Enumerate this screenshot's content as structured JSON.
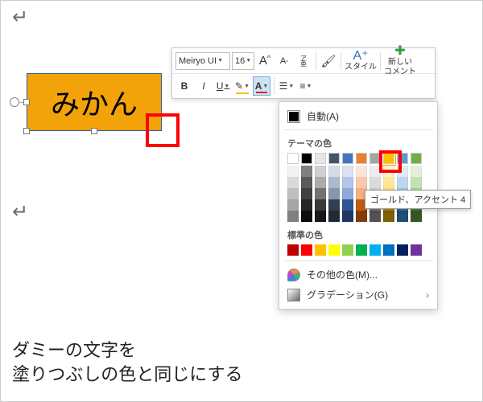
{
  "shape": {
    "text": "みかん"
  },
  "toolbar": {
    "font_name": "Meiryo UI",
    "font_size": "16",
    "grow_font": "A",
    "shrink_font": "A",
    "ruby_top": "ア",
    "ruby_bottom": "亜",
    "style_label": "スタイル",
    "new_comment_label": "新しい\nコメント",
    "bold": "B",
    "italic": "I",
    "underline": "U"
  },
  "color_panel": {
    "auto_label": "自動(A)",
    "theme_title": "テーマの色",
    "standard_title": "標準の色",
    "more_colors": "その他の色(M)...",
    "gradient": "グラデーション(G)",
    "theme_row": [
      "#ffffff",
      "#000000",
      "#e7e6e6",
      "#44546a",
      "#4472c4",
      "#ed7d31",
      "#a5a5a5",
      "#ffc000",
      "#5b9bd5",
      "#70ad47"
    ],
    "shade_cols": [
      [
        "#f2f2f2",
        "#d9d9d9",
        "#bfbfbf",
        "#a6a6a6",
        "#808080"
      ],
      [
        "#808080",
        "#595959",
        "#404040",
        "#262626",
        "#0d0d0d"
      ],
      [
        "#d0cece",
        "#aeaaaa",
        "#757171",
        "#3a3838",
        "#161616"
      ],
      [
        "#d6dce5",
        "#adb9ca",
        "#8497b0",
        "#333f50",
        "#222a35"
      ],
      [
        "#d9e1f2",
        "#b4c6e7",
        "#8ea9db",
        "#2f5597",
        "#1f3864"
      ],
      [
        "#fbe5d6",
        "#f7caac",
        "#f4b183",
        "#c55a11",
        "#843c0c"
      ],
      [
        "#ededed",
        "#dbdbdb",
        "#c9c9c9",
        "#7b7b7b",
        "#525252"
      ],
      [
        "#fff2cc",
        "#ffe699",
        "#ffd966",
        "#bf8f00",
        "#806000"
      ],
      [
        "#deebf7",
        "#bdd7ee",
        "#9dc3e6",
        "#2e75b6",
        "#1f4e79"
      ],
      [
        "#e2efda",
        "#c5e0b4",
        "#a9d08e",
        "#548235",
        "#375623"
      ]
    ],
    "standard_row": [
      "#c00000",
      "#ff0000",
      "#ffc000",
      "#ffff00",
      "#92d050",
      "#00b050",
      "#00b0f0",
      "#0070c0",
      "#002060",
      "#7030a0"
    ]
  },
  "tooltip": "ゴールド、アクセント 4",
  "caption": {
    "line1": "ダミーの文字を",
    "line2": "塗りつぶしの色と同じにする"
  }
}
